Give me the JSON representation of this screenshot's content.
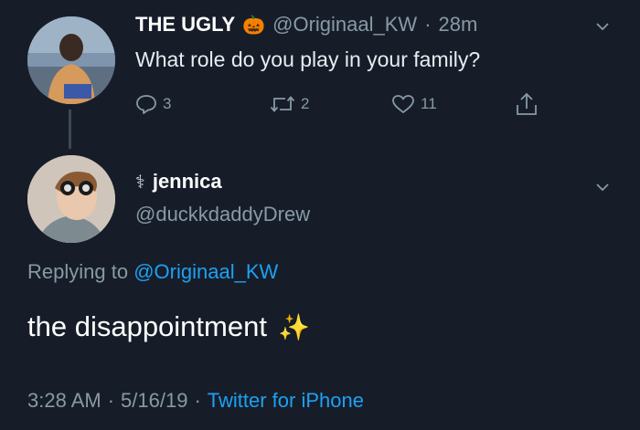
{
  "parent_tweet": {
    "display_name": "THE UGLY",
    "emoji": "🎃",
    "handle": "@Originaal_KW",
    "separator": "·",
    "time_ago": "28m",
    "text": "What role do you play in your family?",
    "actions": {
      "replies": "3",
      "retweets": "2",
      "likes": "11"
    }
  },
  "reply_tweet": {
    "display_name": "jennica",
    "name_prefix_emoji": "⚕",
    "handle": "@duckkdaddyDrew",
    "replying_to_label": "Replying to",
    "replying_to_handle": "@Originaal_KW",
    "text": "the disappointment",
    "emoji": "✨",
    "timestamp_time": "3:28 AM",
    "timestamp_sep1": "·",
    "timestamp_date": "5/16/19",
    "timestamp_sep2": "·",
    "source": "Twitter for iPhone"
  },
  "icons": {
    "reply": "reply-icon",
    "retweet": "retweet-icon",
    "like": "heart-icon",
    "share": "share-icon",
    "menu": "chevron-down-icon"
  },
  "colors": {
    "background": "#161d29",
    "link": "#1da1f2",
    "muted": "#8899a6",
    "text": "#e6ecf0"
  }
}
